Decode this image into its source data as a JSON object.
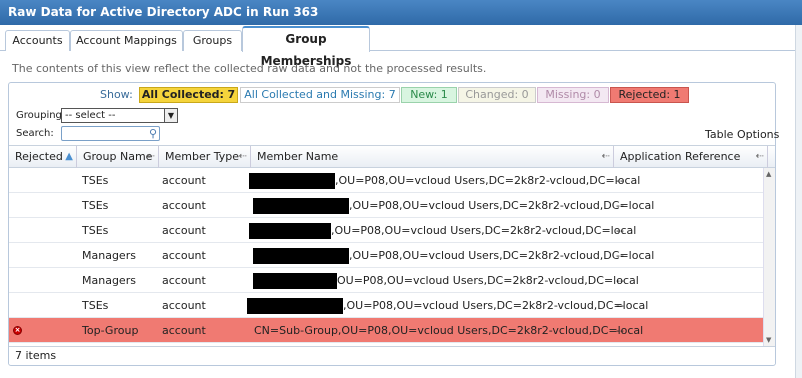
{
  "window": {
    "title": "Raw Data for Active Directory ADC in Run 363"
  },
  "tabs": [
    {
      "label": "Accounts"
    },
    {
      "label": "Account Mappings"
    },
    {
      "label": "Groups"
    },
    {
      "label": "Group Memberships",
      "active": true
    }
  ],
  "note": "The contents of this view reflect the collected raw data and not the processed results.",
  "filters": {
    "show_label": "Show:",
    "chips": [
      {
        "label": "All Collected:",
        "count": "7",
        "color": "#f5d43c",
        "text_color": "#222"
      },
      {
        "label": "All Collected and Missing:",
        "count": "7",
        "color": "#ffffff",
        "text_color": "#2a7ab0"
      },
      {
        "label": "New:",
        "count": "1",
        "color": "#d8f5e0",
        "text_color": "#2a8a4a"
      },
      {
        "label": "Changed:",
        "count": "0",
        "color": "#f5f5e6",
        "text_color": "#999999"
      },
      {
        "label": "Missing:",
        "count": "0",
        "color": "#f3e8f2",
        "text_color": "#b08aa8"
      },
      {
        "label": "Rejected:",
        "count": "1",
        "color": "#f07a72",
        "text_color": "#222"
      }
    ]
  },
  "grouping": {
    "label": "Grouping:",
    "value": "-- select --"
  },
  "search": {
    "label": "Search:",
    "placeholder": ""
  },
  "table_options": "Table Options",
  "table": {
    "columns": [
      "Rejected",
      "Group Name",
      "Member Type",
      "Member Name",
      "Application Reference"
    ],
    "rows": [
      {
        "rejected": false,
        "group": "TSEs",
        "type": "account",
        "member_suffix": ",OU=P08,OU=vcloud Users,DC=2k8r2-vcloud,DC=local",
        "app_ref": "--"
      },
      {
        "rejected": false,
        "group": "TSEs",
        "type": "account",
        "member_suffix": ",OU=P08,OU=vcloud Users,DC=2k8r2-vcloud,DC=local",
        "app_ref": "--"
      },
      {
        "rejected": false,
        "group": "TSEs",
        "type": "account",
        "member_suffix": ",OU=P08,OU=vcloud Users,DC=2k8r2-vcloud,DC=local",
        "app_ref": "--"
      },
      {
        "rejected": false,
        "group": "Managers",
        "type": "account",
        "member_suffix": ",OU=P08,OU=vcloud Users,DC=2k8r2-vcloud,DC=local",
        "app_ref": "--"
      },
      {
        "rejected": false,
        "group": "Managers",
        "type": "account",
        "member_suffix": "OU=P08,OU=vcloud Users,DC=2k8r2-vcloud,DC=local",
        "app_ref": "--"
      },
      {
        "rejected": false,
        "group": "TSEs",
        "type": "account",
        "member_suffix": ",OU=P08,OU=vcloud Users,DC=2k8r2-vcloud,DC=local",
        "app_ref": "--"
      },
      {
        "rejected": true,
        "group": "Top-Group",
        "type": "account",
        "member_full": "CN=Sub-Group,OU=P08,OU=vcloud Users,DC=2k8r2-vcloud,DC=local",
        "app_ref": "--"
      }
    ]
  },
  "footer": "7 items"
}
